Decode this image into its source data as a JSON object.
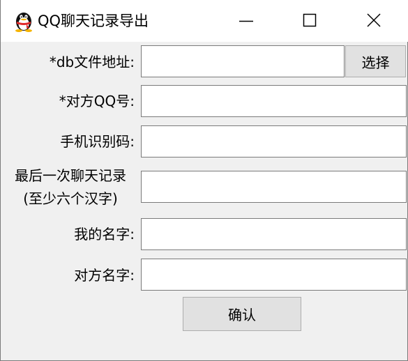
{
  "window": {
    "title": "QQ聊天记录导出",
    "app_icon": "qq-penguin-icon",
    "controls": [
      "minimize-icon",
      "maximize-icon",
      "close-icon"
    ]
  },
  "form": {
    "db_file": {
      "label": "*db文件地址:",
      "value": "",
      "browse_label": "选择"
    },
    "peer_qq": {
      "label": "*对方QQ号:",
      "value": ""
    },
    "phone_code": {
      "label": "手机识别码:",
      "value": ""
    },
    "last_record": {
      "label_line1": "最后一次聊天记录",
      "label_line2": "(至少六个汉字)",
      "value": ""
    },
    "my_name": {
      "label": "我的名字:",
      "value": ""
    },
    "peer_name": {
      "label": "对方名字:",
      "value": ""
    },
    "confirm_label": "确认"
  }
}
